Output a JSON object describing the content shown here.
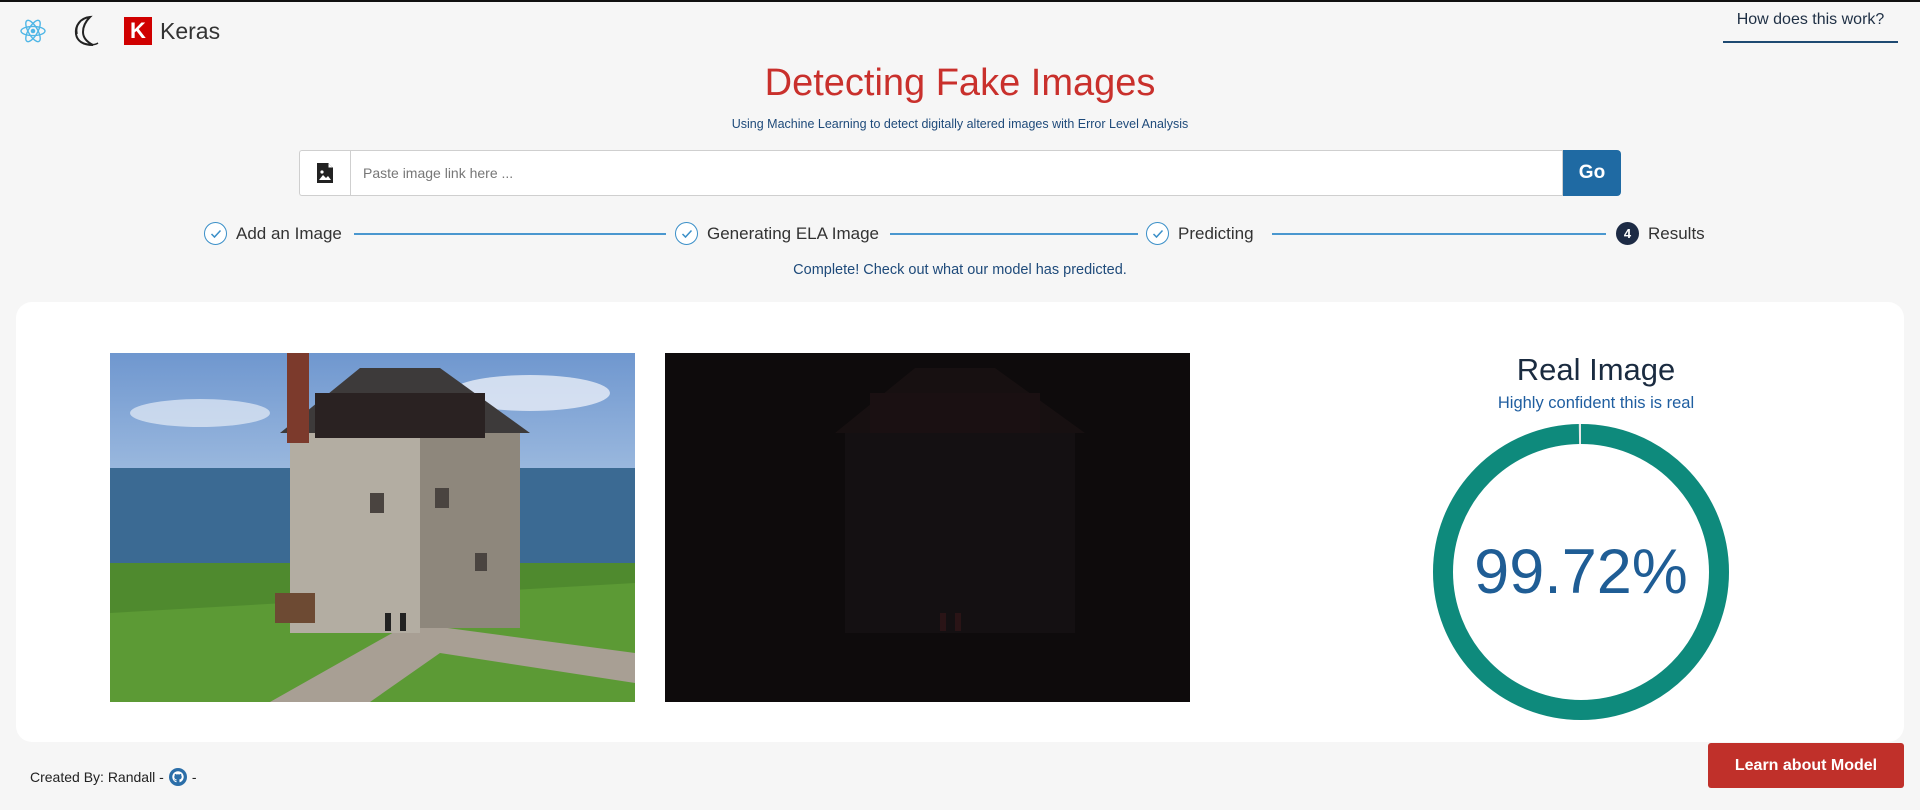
{
  "header": {
    "logos": [
      {
        "icon": "react-logo-icon"
      },
      {
        "icon": "tensorflow-logo-icon"
      },
      {
        "icon": "keras-logo-icon",
        "letter": "K",
        "label": "Keras"
      }
    ],
    "how_link": "How does this work?"
  },
  "hero": {
    "title": "Detecting Fake Images",
    "subtitle": "Using Machine Learning to detect digitally altered images with Error Level Analysis"
  },
  "search": {
    "icon": "image-file-icon",
    "placeholder": "Paste image link here ...",
    "value": "",
    "go_label": "Go"
  },
  "steps": {
    "items": [
      {
        "label": "Add an Image",
        "status": "done"
      },
      {
        "label": "Generating ELA Image",
        "status": "done"
      },
      {
        "label": "Predicting",
        "status": "done"
      },
      {
        "label": "Results",
        "status": "active",
        "number": "4"
      }
    ],
    "caption": "Complete! Check out what our model has predicted."
  },
  "result": {
    "title": "Real Image",
    "subtitle": "Highly confident this is real",
    "confidence_text": "99.72%",
    "confidence_value": 0.9972,
    "ring_color": "#0e8a7c"
  },
  "images": {
    "original_icon": "photo-fort-image",
    "ela_icon": "ela-image"
  },
  "footer": {
    "created_by": "Created By: Randall -",
    "github_icon": "github-icon",
    "trailing": "-"
  },
  "learn_button": "Learn about Model",
  "colors": {
    "accent_red": "#c0302a",
    "accent_blue": "#1f6aa3",
    "ring_teal": "#0e8a7c"
  }
}
